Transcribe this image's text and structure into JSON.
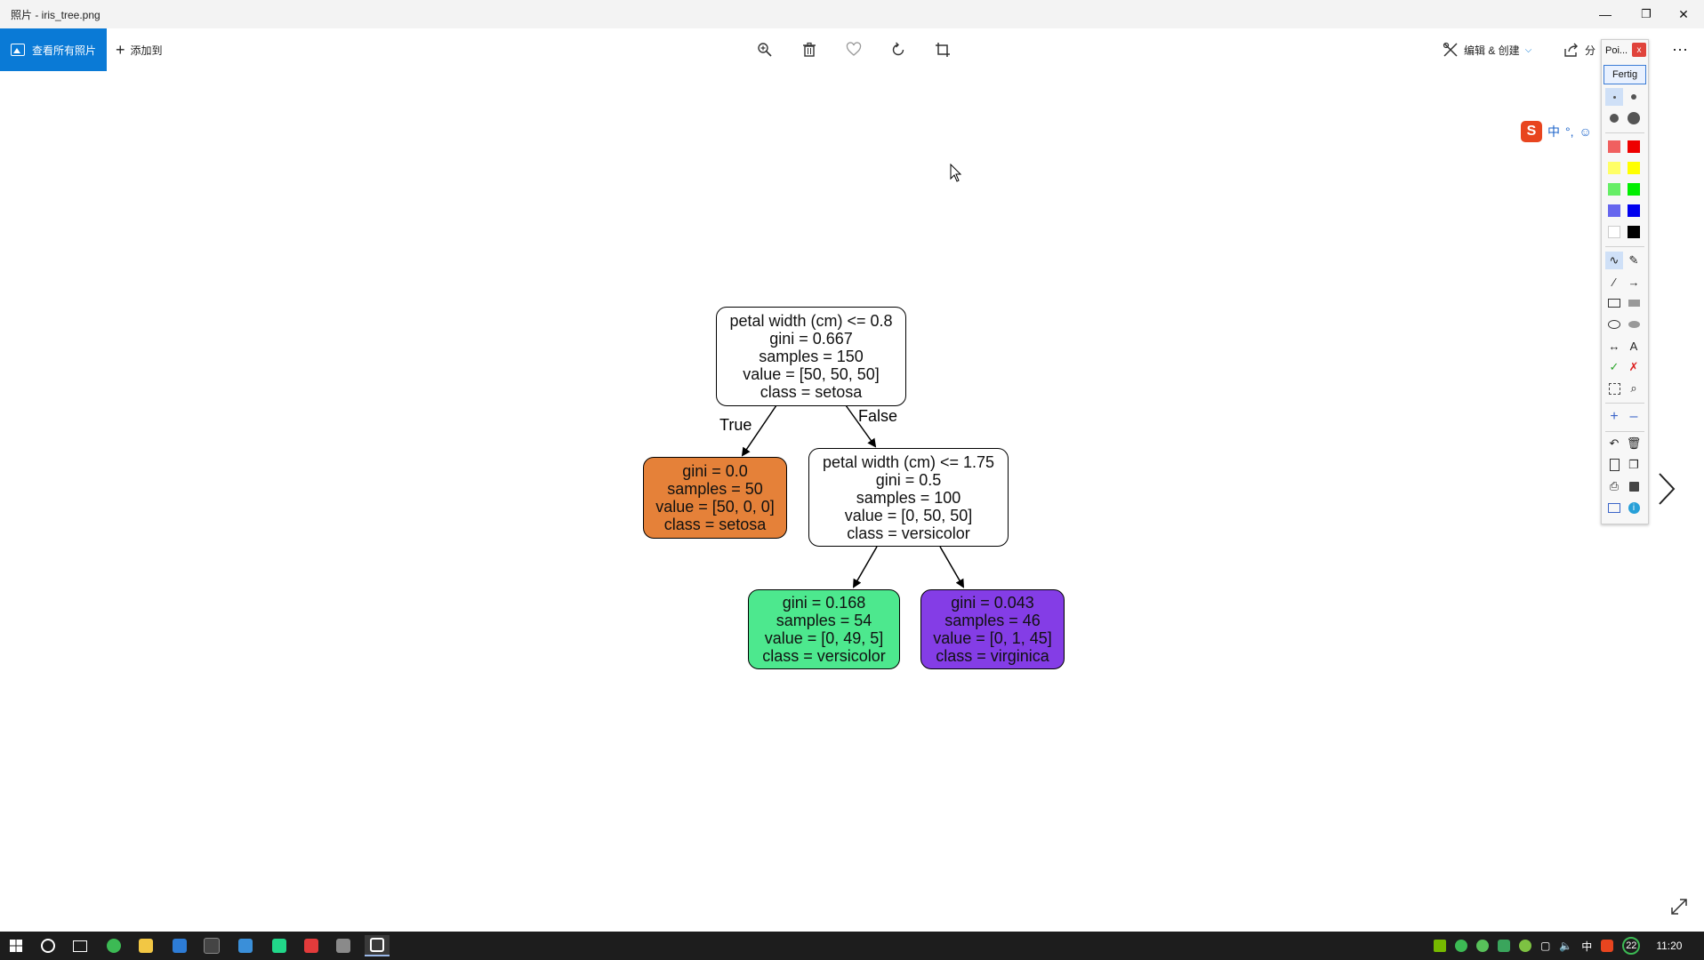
{
  "window": {
    "title": "照片 - iris_tree.png"
  },
  "commandbar": {
    "view_all_label": "查看所有照片",
    "add_to_label": "添加到",
    "edit_create_label": "编辑 & 创建",
    "share_label": "分"
  },
  "paint_toolbar": {
    "title": "Poi...",
    "close_label": "x",
    "done_label": "Fertig",
    "colors": [
      "#f06060",
      "#ee0000",
      "#ffff66",
      "#ffff00",
      "#66ee66",
      "#00ee00",
      "#6666ee",
      "#0000ee",
      "#ffffff",
      "#000000"
    ],
    "text_tool_label": "A"
  },
  "ime": {
    "logo": "S",
    "mode": "中"
  },
  "tree": {
    "root": {
      "lines": [
        "petal width (cm) <= 0.8",
        "gini = 0.667",
        "samples = 150",
        "value = [50, 50, 50]",
        "class = setosa"
      ],
      "fill": "#ffffff"
    },
    "left": {
      "lines": [
        "gini = 0.0",
        "samples = 50",
        "value = [50, 0, 0]",
        "class = setosa"
      ],
      "fill": "#e58139"
    },
    "right": {
      "lines": [
        "petal width (cm) <= 1.75",
        "gini = 0.5",
        "samples = 100",
        "value = [0, 50, 50]",
        "class = versicolor"
      ],
      "fill": "#ffffff"
    },
    "right_left": {
      "lines": [
        "gini = 0.168",
        "samples = 54",
        "value = [0, 49, 5]",
        "class = versicolor"
      ],
      "fill": "#4de88e"
    },
    "right_right": {
      "lines": [
        "gini = 0.043",
        "samples = 46",
        "value = [0, 1, 45]",
        "class = virginica"
      ],
      "fill": "#843de6"
    },
    "edge_true": "True",
    "edge_false": "False"
  },
  "taskbar": {
    "lang": "中",
    "badge": "22",
    "clock": "11:20"
  }
}
